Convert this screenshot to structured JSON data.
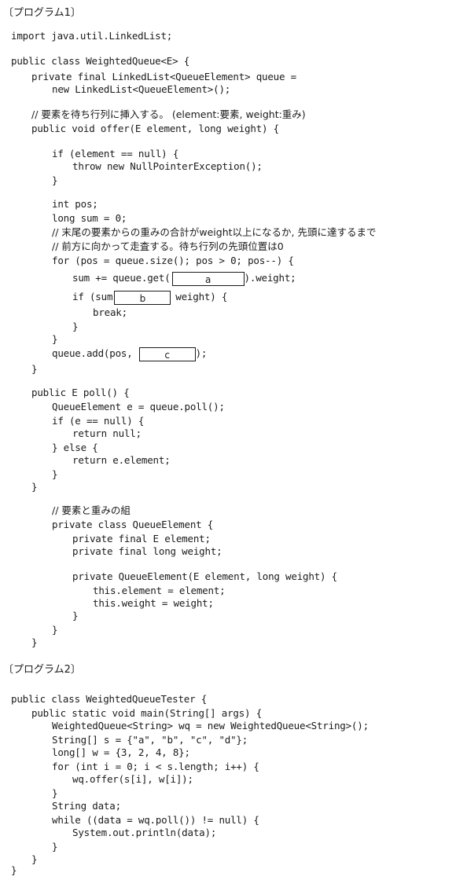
{
  "program1": {
    "heading": "〔プログラム1〕",
    "lines": {
      "import": "import java.util.LinkedList;",
      "class_decl": "public class WeightedQueue<E> {",
      "field1": "private final LinkedList<QueueElement> queue =",
      "field2": "new LinkedList<QueueElement>();",
      "comment_offer": "// 要素を待ち行列に挿入する。 (element:要素, weight:重み)",
      "offer_decl": "public void offer(E element, long weight) {",
      "if_null": "if (element == null) {",
      "throw": "throw new NullPointerException();",
      "close_if": "}",
      "int_pos": "int pos;",
      "long_sum": "long sum = 0;",
      "comment_scan1": "// 末尾の要素からの重みの合計がweight以上になるか, 先頭に達するまで",
      "comment_scan2": "// 前方に向かって走査する。待ち行列の先頭位置は0",
      "for_loop": "for (pos = queue.size(); pos > 0; pos--) {",
      "sum_pre": "sum += queue.get(",
      "sum_post": ").weight;",
      "if_sum_pre": "if (sum",
      "if_sum_post": "weight) {",
      "break": "break;",
      "close_inner_if": "}",
      "close_for": "}",
      "add_pre": "queue.add(pos,",
      "add_post": ");",
      "close_offer": "}",
      "poll_decl": "public E poll() {",
      "poll_e": "QueueElement e = queue.poll();",
      "if_e_null": "if (e == null) {",
      "return_null": "return null;",
      "else": "} else {",
      "return_elem": "return e.element;",
      "close_else": "}",
      "close_poll": "}",
      "comment_pair": "// 要素と重みの組",
      "inner_class": "private class QueueElement {",
      "inner_f1": "private final E element;",
      "inner_f2": "private final long weight;",
      "ctor": "private QueueElement(E element, long weight) {",
      "assign1": "this.element = element;",
      "assign2": "this.weight = weight;",
      "close_ctor": "}",
      "close_inner": "}",
      "close_class": "}"
    },
    "blanks": {
      "a": "a",
      "b": "b",
      "c": "c"
    }
  },
  "program2": {
    "heading": "〔プログラム2〕",
    "lines": {
      "class_decl": "public class WeightedQueueTester {",
      "main_decl": "public static void main(String[] args) {",
      "wq": "WeightedQueue<String> wq = new WeightedQueue<String>();",
      "s_arr": "String[] s = {\"a\", \"b\", \"c\", \"d\"};",
      "w_arr": "long[] w = {3, 2, 4, 8};",
      "for_loop": "for (int i = 0; i < s.length; i++) {",
      "offer_call": "wq.offer(s[i], w[i]);",
      "close_for": "}",
      "data_decl": "String data;",
      "while": "while ((data = wq.poll()) != null) {",
      "println": "System.out.println(data);",
      "close_while": "}",
      "close_main": "}",
      "close_class": "}"
    }
  }
}
